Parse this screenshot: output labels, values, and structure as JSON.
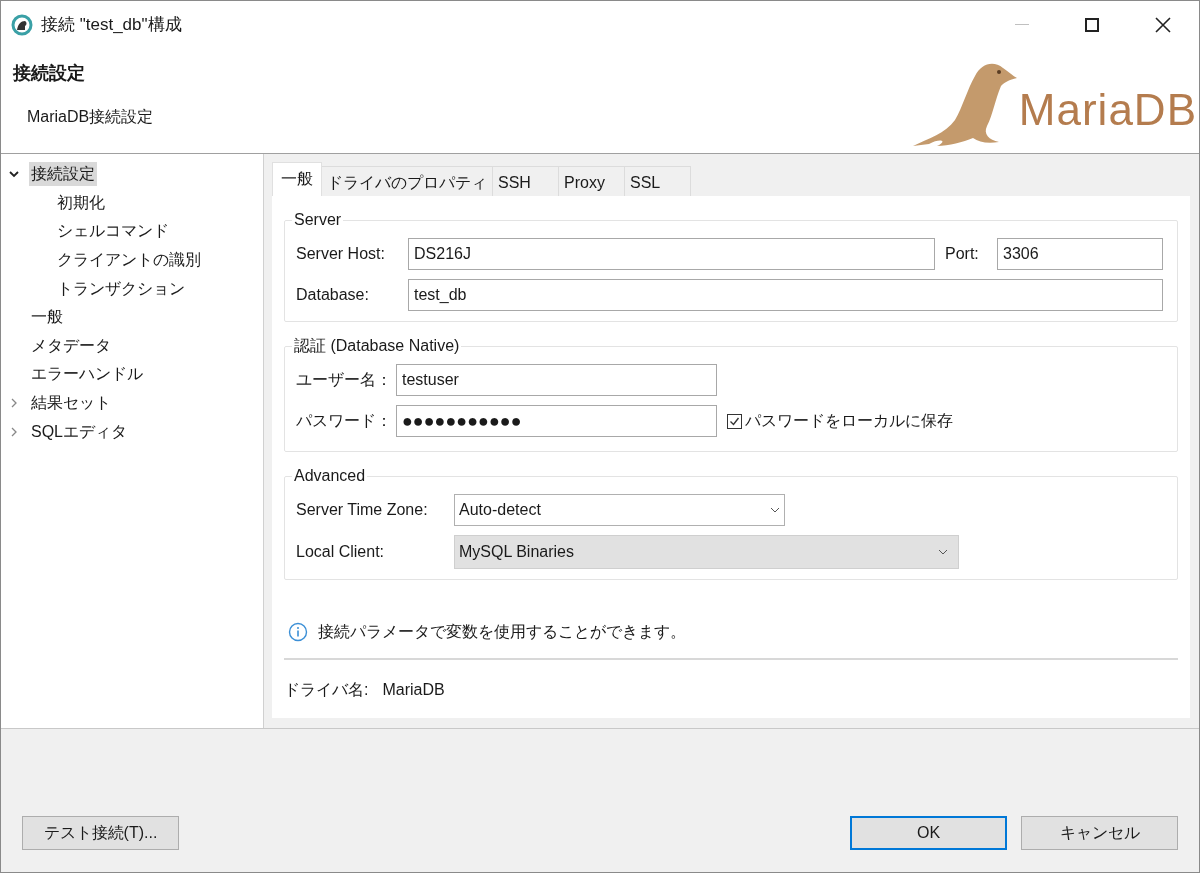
{
  "window": {
    "title": "接続 \"test_db\"構成"
  },
  "header": {
    "title": "接続設定",
    "subtitle": "MariaDB接続設定",
    "logo_text": "MariaDB"
  },
  "tree": [
    {
      "label": "接続設定",
      "selected": true,
      "expanded": true,
      "children": [
        {
          "label": "初期化",
          "selected": false
        },
        {
          "label": "シェルコマンド",
          "selected": false
        },
        {
          "label": "クライアントの識別",
          "selected": false
        },
        {
          "label": "トランザクション",
          "selected": false
        }
      ]
    },
    {
      "label": "一般",
      "selected": false
    },
    {
      "label": "メタデータ",
      "selected": false
    },
    {
      "label": "エラーハンドル",
      "selected": false
    },
    {
      "label": "結果セット",
      "selected": false,
      "expanded": false
    },
    {
      "label": "SQLエディタ",
      "selected": false,
      "expanded": false
    }
  ],
  "tabs": [
    {
      "label": "一般",
      "selected": true
    },
    {
      "label": "ドライバのプロパティ",
      "selected": false
    },
    {
      "label": "SSH",
      "selected": false
    },
    {
      "label": "Proxy",
      "selected": false
    },
    {
      "label": "SSL",
      "selected": false
    }
  ],
  "server": {
    "title": "Server",
    "host_label": "Server Host:",
    "host": "DS216J",
    "port_label": "Port:",
    "port": "3306",
    "database_label": "Database:",
    "database": "test_db"
  },
  "auth": {
    "title": "認証 (Database Native)",
    "user_label": "ユーザー名：",
    "user": "testuser",
    "password_label": "パスワード：",
    "password": "●●●●●●●●●●●",
    "save_password": {
      "label": "パスワードをローカルに保存",
      "checked": true
    }
  },
  "advanced": {
    "title": "Advanced",
    "timezone_label": "Server Time Zone:",
    "timezone": {
      "value": "Auto-detect",
      "disabled": false
    },
    "client_label": "Local Client:",
    "client": {
      "value": "MySQL Binaries",
      "disabled": true
    }
  },
  "info": "接続パラメータで変数を使用することができます。",
  "driver": {
    "label": "ドライバ名:",
    "value": "MariaDB"
  },
  "buttons": [
    {
      "label": "テスト接続(T)...",
      "default": false
    },
    {
      "label": "OK",
      "default": true
    },
    {
      "label": "キャンセル",
      "default": false
    }
  ]
}
